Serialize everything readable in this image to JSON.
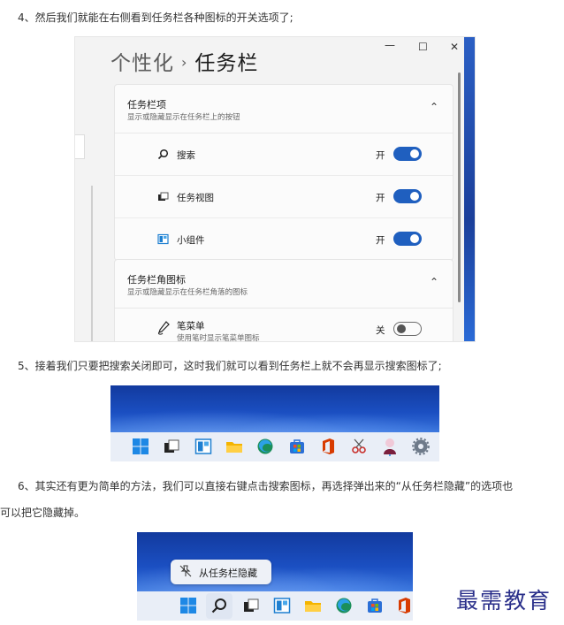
{
  "paragraphs": {
    "step4": "4、然后我们就能在右侧看到任务栏各种图标的开关选项了;",
    "step5": "5、接着我们只要把搜索关闭即可，这时我们就可以看到任务栏上就不会再显示搜索图标了;",
    "step6_line1": "6、其实还有更为简单的方法，我们可以直接右键点击搜索图标，再选择弹出来的“从任务栏隐藏”的选项也",
    "step6_line2": "可以把它隐藏掉。"
  },
  "settings": {
    "breadcrumb_parent": "个性化",
    "breadcrumb_sep": "›",
    "breadcrumb_current": "任务栏",
    "window_controls": {
      "minimize": "—",
      "maximize": "☐",
      "close": "✕"
    },
    "section1": {
      "title": "任务栏项",
      "subtitle": "显示或隐藏显示在任务栏上的按钮",
      "caret": "⌃",
      "items": [
        {
          "icon": "search-icon",
          "label": "搜索",
          "state": "开",
          "on": true
        },
        {
          "icon": "task-view-icon",
          "label": "任务视图",
          "state": "开",
          "on": true
        },
        {
          "icon": "widgets-icon",
          "label": "小组件",
          "state": "开",
          "on": true
        }
      ]
    },
    "section2": {
      "title": "任务栏角图标",
      "subtitle": "显示或隐藏显示在任务栏角落的图标",
      "caret": "⌃",
      "items": [
        {
          "icon": "pen-icon",
          "label": "笔菜单",
          "sub": "使用笔时显示笔菜单图标",
          "state": "关",
          "on": false
        }
      ]
    }
  },
  "context_menu": {
    "icon": "unpin-icon",
    "label": "从任务栏隐藏"
  },
  "watermark": "最需教育",
  "colors": {
    "accent": "#1f5fbf",
    "wallpaper": "#1b4fc2",
    "watermark": "#2a2f8a"
  }
}
